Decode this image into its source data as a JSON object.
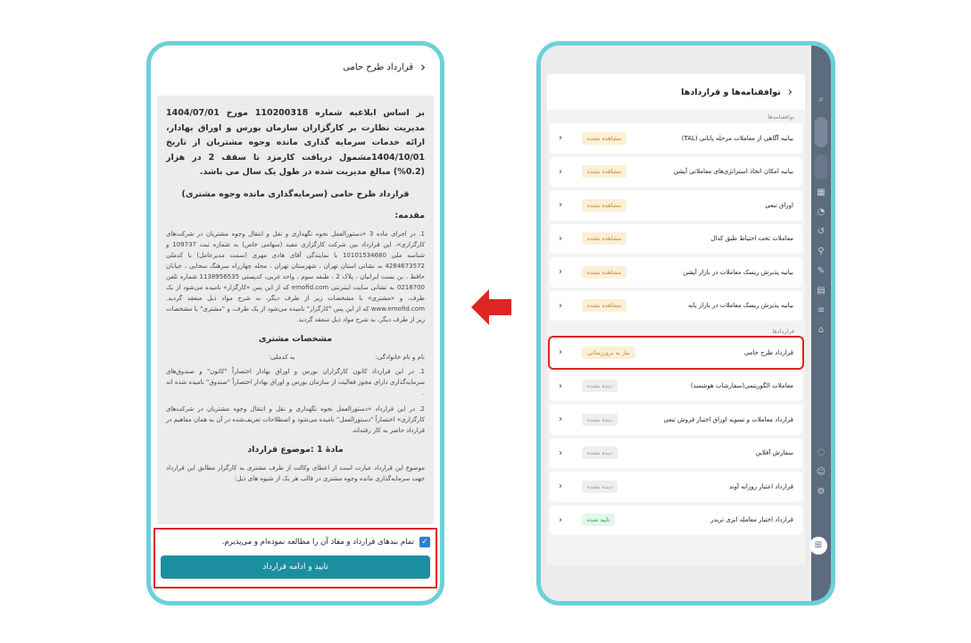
{
  "left_phone": {
    "header": {
      "title": "قرارداد طرح حامی",
      "back_icon": "chevron-right-icon"
    },
    "intro_bold": "بر اساس ابلاغیه شماره 110200318 مورخ 1404/07/01 مدیریت نظارت بر کارگزاران سازمان بورس و اوراق بهادار، ارائه خدمات سرمایه گذاری مانده وجوه مشتریان از تاریخ 1404/10/01مشمول دریافت کارمزد تا سقف 2 در هزار (0.2%) مبالغ مدیریت شده در طول یک سال می باشد.",
    "contract_title": "قرارداد طرح حامی (سرمایه‌گذاری مانده وجوه مشتری)",
    "intro_heading": "مقدمه:",
    "intro_paragraph": "1. در اجرای ماده 3 «دستورالعمل نحوه نگهداری و نقل و انتقال وجوه مشتریان در شرکت‌های کارگزاری»، این قرارداد بین شرکت کارگزاری مفید (سهامی خاص) به شماره ثبت 109737 و شناسه ملی 10101534680 با نمایندگی آقای هادی مهری (سمت مدیرعامل) با کدملی 4284673572 به نشانی استان تهران ، شهرستان تهران ، محله چهارراه سرهنگ سخایی ، خیابان حافظ ، بن بست ایرانیان ، پلاک 2 ، طبقه سوم ، واحد غربی، کدپستی 1138956535 شماره تلفن 0218700 به نشانی سایت اینترنتی emofid.com که از این پس «کارگزار» نامیده می‌شود از یک طرف، و «مشتری» با مشخصات زیر از طرف دیگر، به شرح مواد ذیل منعقد گردید. www.emofid.com که از این پس \"کارگزار\" نامیده می‌شود از یک طرف، و \"مشتری\" با مشخصات زیر از طرف دیگر، به شرح مواد ذیل منعقد گردید.",
    "customer_heading": "مشخصات مشتری",
    "name_label": "نام و نام خانوادگی:",
    "national_code_label": "به کدملی:",
    "para_2": "1. در این قرارداد کانون کارگزاران بورس و اوراق بهادار اختصاراً \"کانون\" و صندوق‌های سرمایه‌گذاری دارای مجوز فعالیت از سازمان بورس و اوراق بهادار اختصاراً \"صندوق\" نامیده شده اند .",
    "para_3": "2. در این قرارداد «دستورالعمل نحوه نگهداری و نقل و انتقال وجوه مشتریان در شرکت‌های کارگزاری» اختصاراً \"دستورالعمل\" نامیده می‌شود و اصطلاحات تعریف‌شده در آن به همان مفاهیم در قرارداد حاضر به کار رفته‌اند.",
    "article_heading": "مادهٔ 1 :موضوع قرارداد",
    "para_4": "موضوع این قرارداد عبارت است از اعطای وکالت از طرف مشتری به کارگزار مطابق این قرارداد جهت سرمایه‌گذاری مانده وجوه مشتری در قالب هر یک از شیوه های ذیل:",
    "agree_text": "تمام بندهای قرارداد و مفاد آن را مطالعه نموده‌ام و می‌پذیرم.",
    "confirm_button": "تایید و ادامه قرارداد"
  },
  "right_phone": {
    "header": {
      "title": "توافقنامه‌ها و قراردادها",
      "back_icon": "chevron-right-icon"
    },
    "section_agreements": "توافقنامه‌ها",
    "agreements": [
      {
        "label": "بیانیه آگاهی از معاملات مرحله پایانی (TAL)",
        "status": "مشاهده نشده",
        "kind": "seen"
      },
      {
        "label": "بیانیه امکان اتخاذ استراتژی‌های معاملاتی آپشن",
        "status": "مشاهده نشده",
        "kind": "seen"
      },
      {
        "label": "اوراق تبعی",
        "status": "مشاهده نشده",
        "kind": "seen"
      },
      {
        "label": "معاملات تحت احتیاط طبق کدال",
        "status": "مشاهده نشده",
        "kind": "seen"
      },
      {
        "label": "بیانیه پذیرش ریسک معاملات در بازار آپشن",
        "status": "مشاهده نشده",
        "kind": "seen"
      },
      {
        "label": "بیانیه پذیرش ریسک معاملات در بازار پایه",
        "status": "مشاهده نشده",
        "kind": "seen"
      }
    ],
    "section_contracts": "قراردادها",
    "contracts": [
      {
        "label": "قرارداد طرح حامی",
        "status": "نیاز به بروزرسانی",
        "kind": "review",
        "highlight": true
      },
      {
        "label": "معاملات الگوریتمی(سفارشات هوشمند)",
        "status": "دیده نشده",
        "kind": "notseen"
      },
      {
        "label": "قرارداد معاملات و تسویه اوراق اختیار فروش تبعی",
        "status": "دیده نشده",
        "kind": "notseen"
      },
      {
        "label": "سفارش آفلاین",
        "status": "دیده نشده",
        "kind": "notseen"
      },
      {
        "label": "قرارداد اعتبار روزانه آوند",
        "status": "دیده نشده",
        "kind": "notseen"
      },
      {
        "label": "قرارداد اختیار معامله ابزی تریدر",
        "status": "تایید شده",
        "kind": "ok"
      }
    ]
  },
  "colors": {
    "phone_border": "#6dd0d8",
    "highlight": "#e02424",
    "button": "#1b8ea0",
    "sidebar": "#5c6b7e",
    "arrow": "#e02424"
  }
}
